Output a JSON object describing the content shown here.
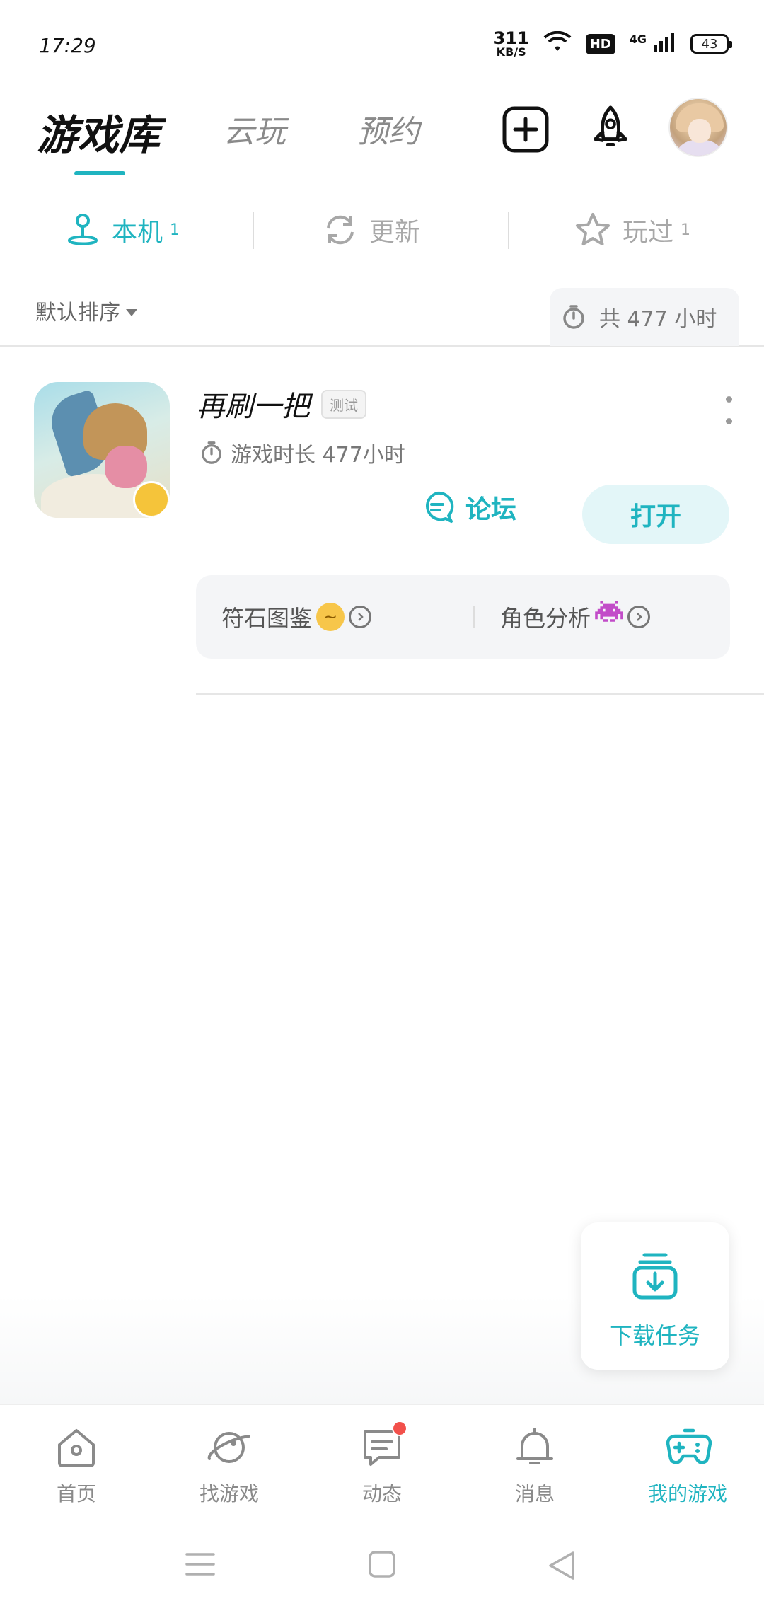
{
  "status_bar": {
    "time": "17:29",
    "net_speed": "311",
    "net_speed_unit": "KB/S",
    "hd": "HD",
    "network": "4G",
    "battery": "43"
  },
  "top_nav": {
    "tabs": [
      {
        "label": "游戏库",
        "active": true
      },
      {
        "label": "云玩",
        "active": false
      },
      {
        "label": "预约",
        "active": false
      }
    ],
    "add_icon": "plus-square-icon",
    "rocket_icon": "rocket-icon"
  },
  "sub_tabs": [
    {
      "label": "本机",
      "count": "1",
      "icon": "joystick-icon",
      "active": true
    },
    {
      "label": "更新",
      "count": "",
      "icon": "refresh-icon",
      "active": false
    },
    {
      "label": "玩过",
      "count": "1",
      "icon": "star-icon",
      "active": false
    }
  ],
  "sort": {
    "label": "默认排序",
    "total_time": "共 477 小时"
  },
  "game": {
    "title": "再刷一把",
    "badge": "测试",
    "play_time": "游戏时长 477小时",
    "forum_label": "论坛",
    "open_label": "打开",
    "shortcuts": [
      {
        "label": "符石图鉴",
        "emoji": "smirk-emoji"
      },
      {
        "label": "角色分析",
        "emoji": "space-invader-emoji"
      }
    ]
  },
  "download_fab": {
    "label": "下载任务"
  },
  "bottom_nav": [
    {
      "label": "首页",
      "icon": "home-icon",
      "active": false
    },
    {
      "label": "找游戏",
      "icon": "planet-icon",
      "active": false
    },
    {
      "label": "动态",
      "icon": "chat-icon",
      "active": false,
      "dot": true
    },
    {
      "label": "消息",
      "icon": "bell-icon",
      "active": false
    },
    {
      "label": "我的游戏",
      "icon": "gamepad-icon",
      "active": true
    }
  ],
  "colors": {
    "accent": "#1fb4c0",
    "accent_light": "#e3f6f8",
    "badge_red": "#f2504b"
  }
}
